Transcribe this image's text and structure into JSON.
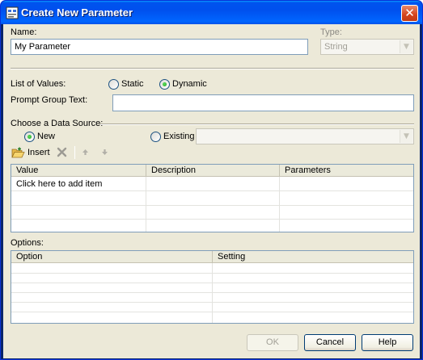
{
  "window": {
    "title": "Create New Parameter",
    "close_glyph": "✕"
  },
  "name": {
    "label": "Name:",
    "value": "My Parameter"
  },
  "type": {
    "label": "Type:",
    "value": "String"
  },
  "list_of_values": {
    "label": "List of Values:",
    "options": [
      {
        "label": "Static",
        "checked": false
      },
      {
        "label": "Dynamic",
        "checked": true
      }
    ]
  },
  "prompt_group": {
    "label": "Prompt Group Text:",
    "value": ""
  },
  "data_source": {
    "label": "Choose a Data Source:",
    "options": [
      {
        "label": "New",
        "checked": true
      },
      {
        "label": "Existing",
        "checked": false
      }
    ],
    "existing_value": ""
  },
  "toolbar": {
    "insert_label": "Insert",
    "icons": [
      "folder-open-icon",
      "delete-icon",
      "move-up-icon",
      "move-down-icon"
    ]
  },
  "values_table": {
    "columns": [
      "Value",
      "Description",
      "Parameters"
    ],
    "rows": [
      [
        "Click here to add item",
        "",
        ""
      ],
      [
        "",
        "",
        ""
      ],
      [
        "",
        "",
        ""
      ],
      [
        "",
        "",
        ""
      ]
    ]
  },
  "options": {
    "label": "Options:",
    "columns": [
      "Option",
      "Setting"
    ],
    "rows": [
      [
        "",
        ""
      ],
      [
        "",
        ""
      ],
      [
        "",
        ""
      ],
      [
        "",
        ""
      ],
      [
        "",
        ""
      ],
      [
        "",
        ""
      ]
    ]
  },
  "buttons": {
    "ok": "OK",
    "cancel": "Cancel",
    "help": "Help"
  },
  "colors": {
    "titlebar": "#0053ee",
    "client": "#ece9d8",
    "accent_border": "#7f9db9"
  }
}
